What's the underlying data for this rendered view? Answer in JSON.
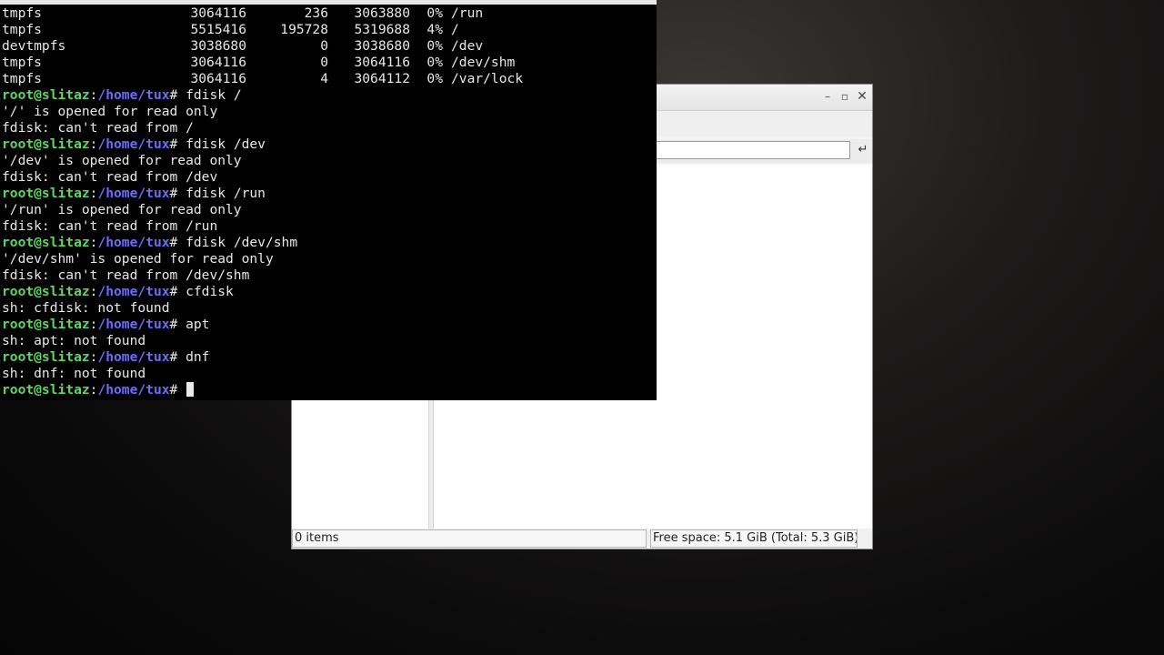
{
  "file_manager": {
    "window_controls": {
      "minimize": "–",
      "maximize": "▫",
      "close": "✕"
    },
    "path_value": "",
    "go_icon": "↵",
    "status": {
      "items": "0 items",
      "free_space": "Free space: 5.1 GiB (Total: 5.3 GiB)"
    }
  },
  "terminal": {
    "prompt": {
      "user": "root@slitaz",
      "sep": ":",
      "path": "/home/tux",
      "hash": "# "
    },
    "df_rows": [
      {
        "fs": "tmpfs",
        "size": "3064116",
        "used": "236",
        "avail": "3063880",
        "pct": "0%",
        "mount": "/run"
      },
      {
        "fs": "tmpfs",
        "size": "5515416",
        "used": "195728",
        "avail": "5319688",
        "pct": "4%",
        "mount": "/"
      },
      {
        "fs": "devtmpfs",
        "size": "3038680",
        "used": "0",
        "avail": "3038680",
        "pct": "0%",
        "mount": "/dev"
      },
      {
        "fs": "tmpfs",
        "size": "3064116",
        "used": "0",
        "avail": "3064116",
        "pct": "0%",
        "mount": "/dev/shm"
      },
      {
        "fs": "tmpfs",
        "size": "3064116",
        "used": "4",
        "avail": "3064112",
        "pct": "0%",
        "mount": "/var/lock"
      }
    ],
    "session": [
      {
        "cmd": "fdisk /",
        "output": [
          "'/' is opened for read only",
          "fdisk: can't read from /"
        ]
      },
      {
        "cmd": "fdisk /dev",
        "output": [
          "'/dev' is opened for read only",
          "fdisk: can't read from /dev"
        ]
      },
      {
        "cmd": "fdisk /run",
        "output": [
          "'/run' is opened for read only",
          "fdisk: can't read from /run"
        ]
      },
      {
        "cmd": "fdisk /dev/shm",
        "output": [
          "'/dev/shm' is opened for read only",
          "fdisk: can't read from /dev/shm"
        ]
      },
      {
        "cmd": "cfdisk",
        "output": [
          "sh: cfdisk: not found"
        ]
      },
      {
        "cmd": "apt",
        "output": [
          "sh: apt: not found"
        ]
      },
      {
        "cmd": "dnf",
        "output": [
          "sh: dnf: not found"
        ]
      }
    ],
    "current_input": ""
  }
}
